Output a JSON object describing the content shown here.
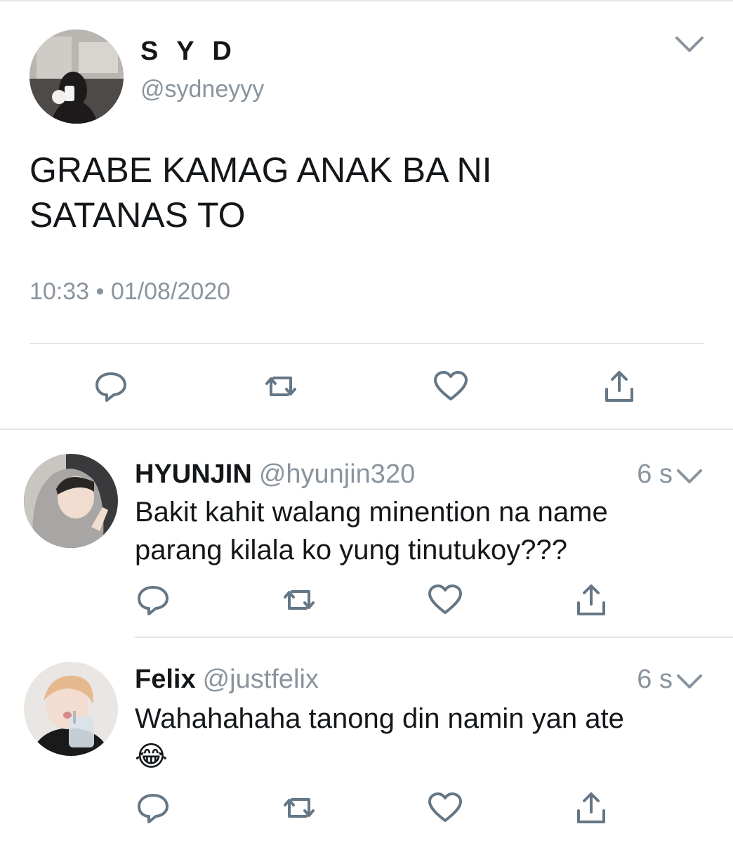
{
  "main": {
    "display_name": "S Y D",
    "handle": "@sydneyyy",
    "text_line1": "GRABE KAMAG ANAK BA NI",
    "text_line2": "SATANAS TO",
    "timestamp": "10:33 • 01/08/2020",
    "caret_icon": "chevron-down-icon",
    "actions": [
      "reply-icon",
      "retweet-icon",
      "like-icon",
      "share-icon"
    ]
  },
  "replies": [
    {
      "display_name": "HYUNJIN",
      "handle": "@hyunjin320",
      "time": "6 s",
      "text_line1": "Bakit kahit walang minention na name",
      "text_line2": "parang kilala ko yung tinutukoy???"
    },
    {
      "display_name": "Felix",
      "handle": "@justfelix",
      "time": "6 s",
      "text_line1": "Wahahahaha tanong din namin yan ate",
      "emoji": "😂"
    }
  ],
  "colors": {
    "text": "#14171a",
    "secondary": "#8a949e",
    "icon": "#657786",
    "divider": "#e1e6ea"
  }
}
